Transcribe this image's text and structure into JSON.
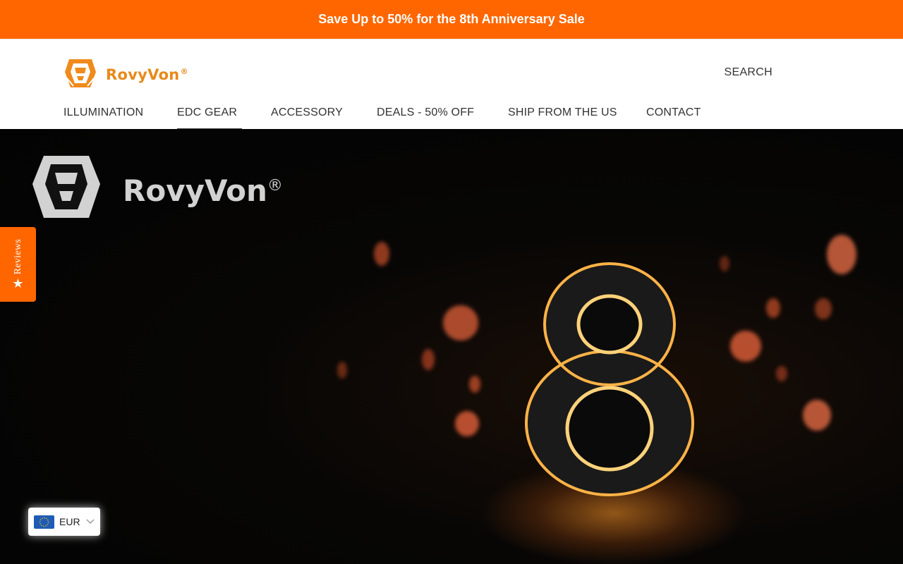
{
  "announcement": {
    "text": "Save Up to 50% for the 8th Anniversary Sale"
  },
  "header": {
    "brand": "RovyVon",
    "brand_mark": "®",
    "search_label": "SEARCH"
  },
  "nav": {
    "items": [
      {
        "label": "ILLUMINATION"
      },
      {
        "label": "EDC GEAR",
        "active": true
      },
      {
        "label": "ACCESSORY"
      },
      {
        "label": "DEALS - 50% OFF"
      },
      {
        "label": "SHIP FROM THE US"
      },
      {
        "label": "CONTACT"
      }
    ]
  },
  "hero": {
    "brand": "RovyVon",
    "brand_mark": "®",
    "numeral": "8"
  },
  "reviews_tab": {
    "label": "Reviews",
    "icon": "star-icon"
  },
  "currency": {
    "code": "EUR",
    "icon": "eu-flag-icon"
  },
  "colors": {
    "accent": "#ff6600",
    "brand": "#e8891a",
    "glow": "#ffb347"
  }
}
